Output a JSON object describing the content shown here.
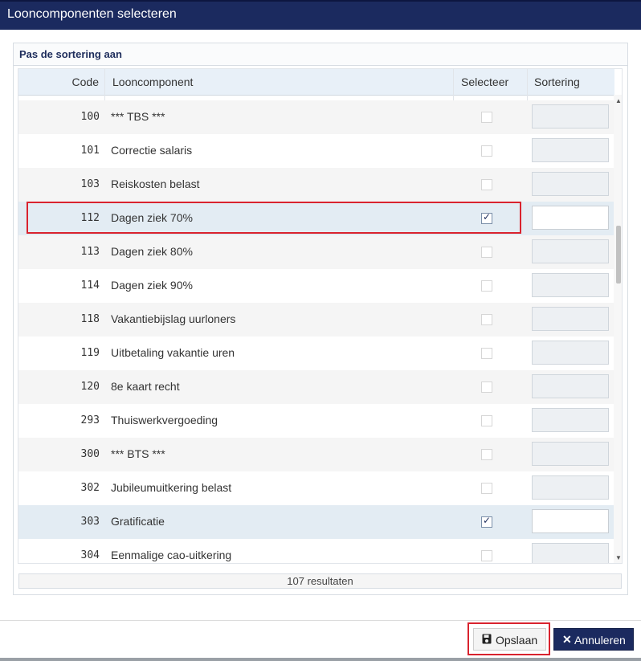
{
  "dialog": {
    "title": "Looncomponenten selecteren"
  },
  "panel": {
    "title": "Pas de sortering aan"
  },
  "grid": {
    "columns": {
      "code": "Code",
      "name": "Looncomponent",
      "select": "Selecteer",
      "sort": "Sortering"
    },
    "rows": [
      {
        "code": "100",
        "name": "*** TBS ***",
        "selected": false
      },
      {
        "code": "101",
        "name": "Correctie salaris",
        "selected": false
      },
      {
        "code": "103",
        "name": "Reiskosten belast",
        "selected": false
      },
      {
        "code": "112",
        "name": "Dagen ziek 70%",
        "selected": true
      },
      {
        "code": "113",
        "name": "Dagen ziek 80%",
        "selected": false
      },
      {
        "code": "114",
        "name": "Dagen ziek 90%",
        "selected": false
      },
      {
        "code": "118",
        "name": "Vakantiebijslag uurloners",
        "selected": false
      },
      {
        "code": "119",
        "name": "Uitbetaling vakantie uren",
        "selected": false
      },
      {
        "code": "120",
        "name": "8e kaart recht",
        "selected": false
      },
      {
        "code": "293",
        "name": "Thuiswerkvergoeding",
        "selected": false
      },
      {
        "code": "300",
        "name": "*** BTS ***",
        "selected": false
      },
      {
        "code": "302",
        "name": "Jubileumuitkering belast",
        "selected": false
      },
      {
        "code": "303",
        "name": "Gratificatie",
        "selected": true
      },
      {
        "code": "304",
        "name": "Eenmalige cao-uitkering",
        "selected": false
      }
    ],
    "results": "107 resultaten"
  },
  "buttons": {
    "save": "Opslaan",
    "cancel": "Annuleren"
  },
  "colors": {
    "titlebar": "#1b2a5f",
    "highlight": "#d9232e",
    "selectedRow": "#e3ecf3"
  }
}
